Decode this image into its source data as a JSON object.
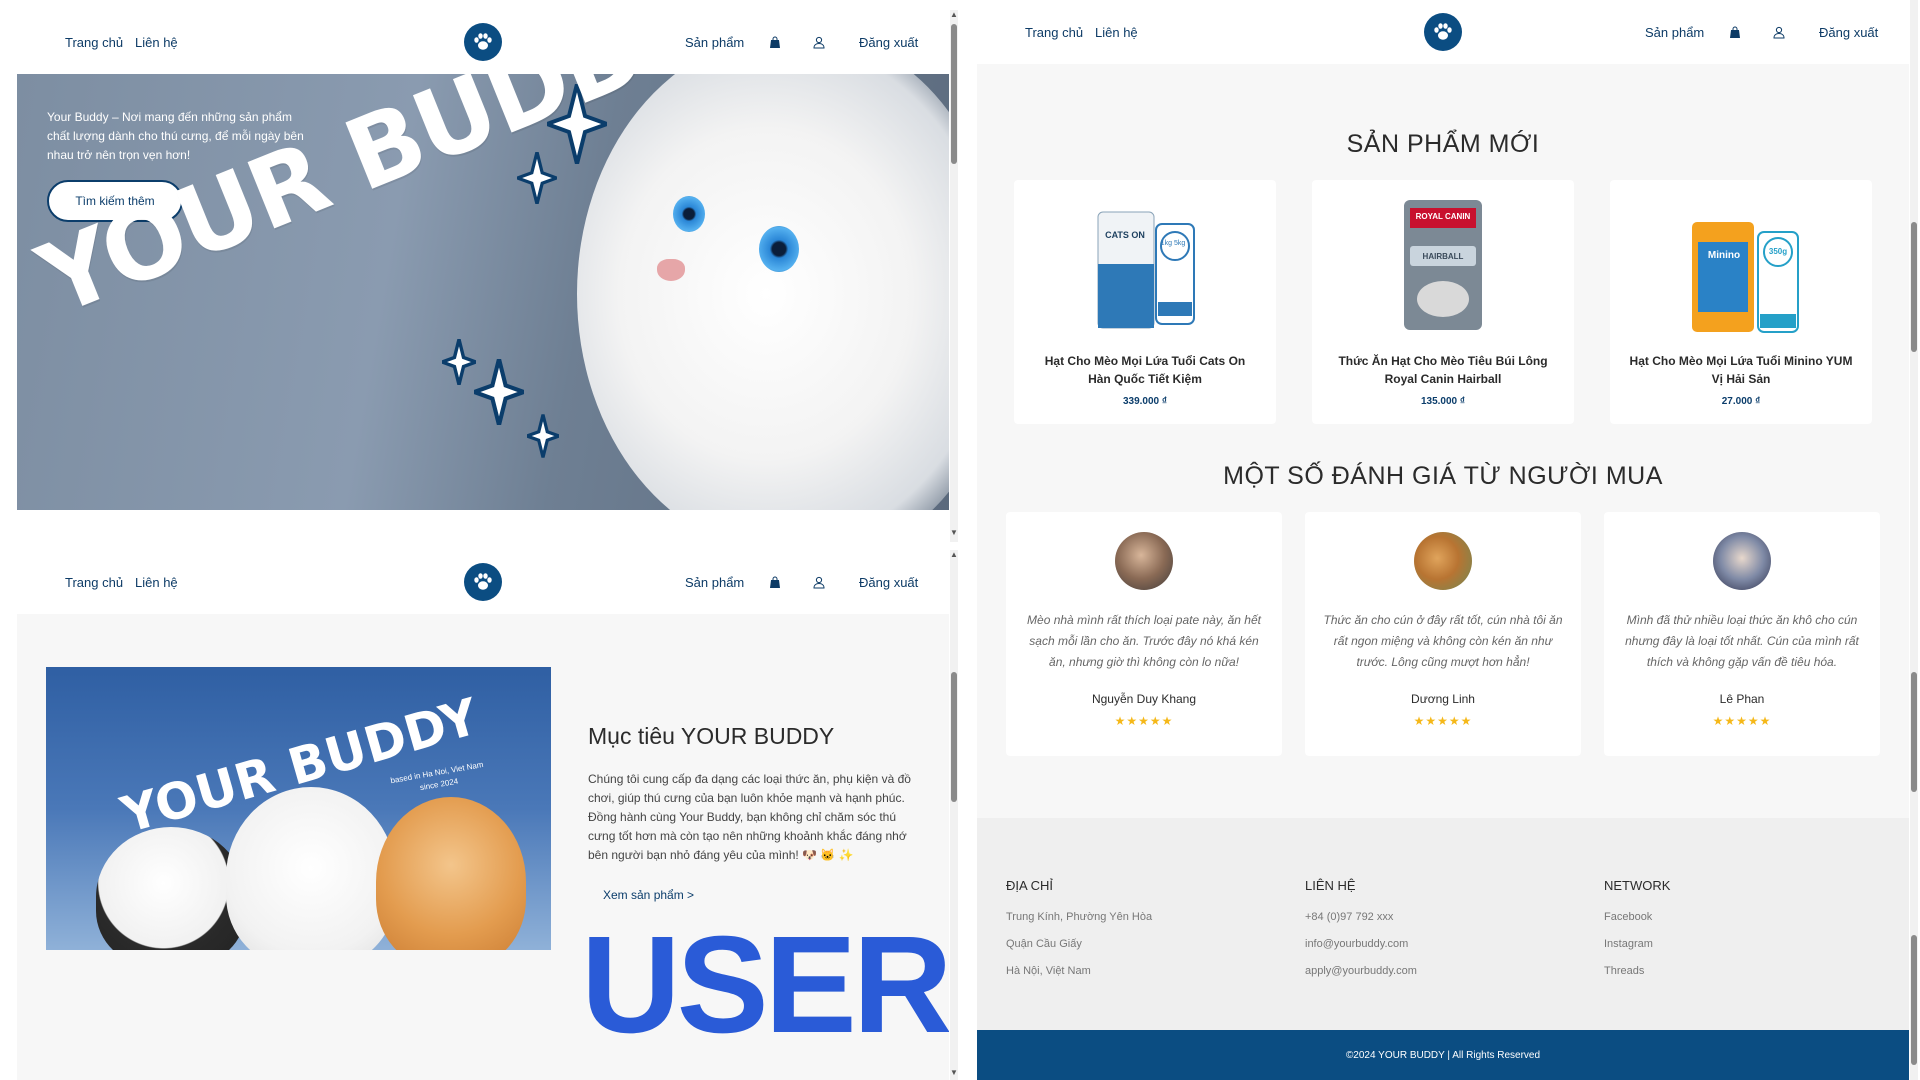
{
  "nav": {
    "home": "Trang chủ",
    "contact": "Liên hệ",
    "products": "Sản phẩm",
    "logout": "Đăng xuất"
  },
  "hero": {
    "intro": "Your Buddy – Nơi mang đến những sản phẩm chất lượng dành cho thú cưng, để mỗi ngày bên nhau trở nên trọn vẹn hơn!",
    "cta": "Tìm kiếm thêm",
    "title": "YOUR BUDDY"
  },
  "about": {
    "banner_title": "YOUR BUDDY",
    "banner_sub": "based in Ha Noi, Viet Nam\nsince 2024",
    "heading": "Mục tiêu YOUR BUDDY",
    "body": "Chúng tôi cung cấp đa dạng các loại thức ăn, phụ kiện và đồ chơi, giúp thú cưng của bạn luôn khỏe mạnh và hạnh phúc. Đồng hành cùng Your Buddy, bạn không chỉ chăm sóc thú cưng tốt hơn mà còn tạo nên những khoảnh khắc đáng nhớ bên người bạn nhỏ đáng yêu của mình! 🐶 🐱 ✨",
    "link": "Xem sản phẩm >",
    "big_label": "USER"
  },
  "new_products": {
    "title": "SẢN PHẨM MỚI",
    "items": [
      {
        "name": "Hạt Cho Mèo Mọi Lứa Tuổi Cats On Hàn Quốc Tiết Kiệm",
        "price": "339.000 ₫",
        "pack_label": "CATS ON",
        "badge": "1kg 5kg"
      },
      {
        "name": "Thức Ăn Hạt Cho Mèo Tiêu Búi Lông Royal Canin Hairball",
        "price": "135.000 ₫",
        "pack_label": "ROYAL CANIN",
        "badge": "HAIRBALL"
      },
      {
        "name": "Hạt Cho Mèo Mọi Lứa Tuổi Minino YUM Vị Hải Sản",
        "price": "27.000 ₫",
        "pack_label": "Minino",
        "badge": "350g"
      }
    ]
  },
  "reviews": {
    "title": "MỘT SỐ ĐÁNH GIÁ TỪ NGƯỜI MUA",
    "items": [
      {
        "text": "Mèo nhà mình rất thích loại pate này, ăn hết sạch mỗi lần cho ăn. Trước đây nó khá kén ăn, nhưng giờ thì không còn lo nữa!",
        "name": "Nguyễn Duy Khang",
        "stars": "★★★★★"
      },
      {
        "text": "Thức ăn cho cún ở đây rất tốt, cún nhà tôi ăn rất ngon miệng và không còn kén ăn như trước. Lông cũng mượt hơn hẳn!",
        "name": "Dương Linh",
        "stars": "★★★★★"
      },
      {
        "text": "Mình đã thử nhiều loại thức ăn khô cho cún nhưng đây là loại tốt nhất. Cún của mình rất thích và không gặp vấn đề tiêu hóa.",
        "name": "Lê Phan",
        "stars": "★★★★★"
      }
    ]
  },
  "footer": {
    "address": {
      "title": "ĐỊA CHỈ",
      "lines": [
        "Trung Kính, Phường Yên Hòa",
        "Quận Cầu Giấy",
        "Hà Nội, Việt Nam"
      ]
    },
    "contact": {
      "title": "LIÊN HỆ",
      "lines": [
        "+84 (0)97 792 xxx",
        "info@yourbuddy.com",
        "apply@yourbuddy.com"
      ]
    },
    "network": {
      "title": "NETWORK",
      "lines": [
        "Facebook",
        "Instagram",
        "Threads"
      ]
    },
    "copyright": "©2024 YOUR BUDDY | All Rights Reserved"
  },
  "colors": {
    "primary": "#0b4d82",
    "accent_text": "#0d3b66",
    "user_label": "#2a5bd7",
    "star": "#f5b819"
  },
  "icons": [
    "paw-logo-icon",
    "shopping-bag-icon",
    "user-icon",
    "scroll-up-arrow-icon",
    "scroll-down-arrow-icon"
  ]
}
